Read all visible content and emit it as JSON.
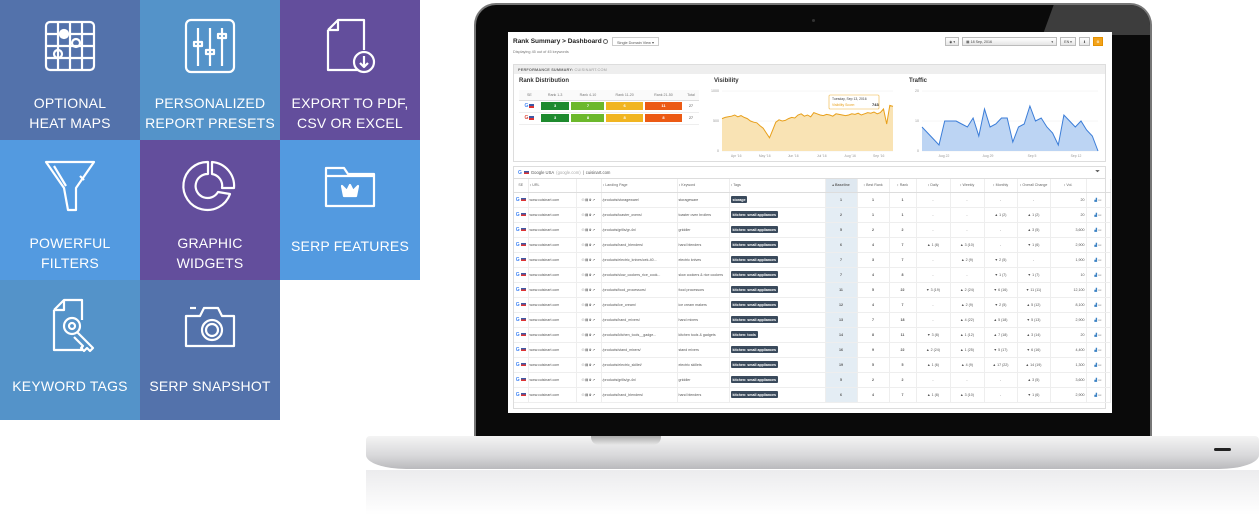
{
  "features": [
    {
      "label": "OPTIONAL\nHEAT MAPS",
      "icon": "heat-map-icon",
      "color": "#5372ab"
    },
    {
      "label": "PERSONALIZED\nREPORT PRESETS",
      "icon": "sliders-icon",
      "color": "#5493c9"
    },
    {
      "label": "EXPORT TO PDF,\nCSV OR EXCEL",
      "icon": "export-file-icon",
      "color": "#634e9c"
    },
    {
      "label": "POWERFUL\nFILTERS",
      "icon": "funnel-icon",
      "color": "#539ae0"
    },
    {
      "label": "GRAPHIC\nWIDGETS",
      "icon": "donut-chart-icon",
      "color": "#634e9c"
    },
    {
      "label": "SERP FEATURES",
      "icon": "folder-crown-icon",
      "color": "#539ae0"
    },
    {
      "label": "KEYWORD TAGS",
      "icon": "document-key-icon",
      "color": "#5493c9"
    },
    {
      "label": "SERP SNAPSHOT",
      "icon": "camera-icon",
      "color": "#5372ab"
    }
  ],
  "app": {
    "title": "Rank Summary > Dashboard",
    "view_select": "Single Domain View",
    "displaying": "Displaying 45 out of 45 keywords",
    "date": "18 Sep, 2016",
    "language": "EN",
    "perf_label": "PERFORMANCE SUMMARY:",
    "perf_domain": "CUISINART.COM"
  },
  "rank_distribution": {
    "title": "Rank Distribution",
    "headers": [
      "SE",
      "Rank 1-3",
      "Rank 4-10",
      "Rank 11-20",
      "Rank 21-50",
      "Total"
    ],
    "rows": [
      {
        "se": "google",
        "values": [
          3,
          7,
          6,
          11
        ],
        "total": 27
      },
      {
        "se": "google-mobile",
        "values": [
          3,
          8,
          8,
          8
        ],
        "total": 27
      }
    ]
  },
  "chart_data": [
    {
      "type": "area",
      "title": "Visibility",
      "ylim": [
        0,
        1000
      ],
      "yticks": [
        "0",
        "500",
        "1000"
      ],
      "xticks": [
        "Apr '16",
        "May '16",
        "Jun '16",
        "Jul '16",
        "Aug '16",
        "Sep '16"
      ],
      "values": [
        540,
        560,
        570,
        580,
        600,
        570,
        590,
        560,
        540,
        500,
        480,
        470,
        420,
        380,
        300,
        220,
        350,
        480,
        520,
        500,
        510,
        540,
        560,
        550,
        600,
        620,
        580,
        600,
        570,
        640,
        620,
        600,
        590,
        610,
        600,
        580,
        620,
        610,
        600,
        590,
        600,
        620,
        610,
        630,
        600,
        620,
        640,
        630,
        650,
        620,
        640,
        700,
        450,
        760,
        743
      ],
      "tooltip": {
        "date": "Tuesday, Sep 13, 2016",
        "label": "Visibility Score:",
        "value": "743"
      }
    },
    {
      "type": "area",
      "title": "Traffic",
      "ylim": [
        0,
        20
      ],
      "yticks": [
        "0",
        "10",
        "20"
      ],
      "xticks": [
        "Aug 22",
        "Aug 29",
        "Sep 5",
        "Sep 12"
      ],
      "values": [
        8,
        6,
        4,
        2,
        10,
        10,
        10,
        9,
        8,
        11,
        5,
        14,
        8,
        9,
        11,
        11,
        3,
        8,
        9,
        15,
        10,
        11,
        8,
        6,
        2,
        12,
        10,
        8,
        10,
        7,
        5,
        0
      ]
    }
  ],
  "keywords": {
    "engine": "Google USA",
    "engine_sub": "(google.com)",
    "domain": "cuisinart.com",
    "headers": [
      "SE",
      "URL",
      "",
      "Landing Page",
      "Keyword",
      "Tags",
      "Baseline",
      "Best Rank",
      "Rank",
      "Daily",
      "Weekly",
      "Monthly",
      "Overall Change",
      "Vol.",
      ""
    ],
    "rows": [
      {
        "url": "www.cuisinart.com",
        "page": "/products/storageware/",
        "kw": "storageware",
        "tag": "storage",
        "base": "1",
        "best": "1",
        "rank": "1",
        "daily": "-",
        "weekly": "-",
        "monthly": "-",
        "overall": "-",
        "vol": "20"
      },
      {
        "url": "www.cuisinart.com",
        "page": "/products/toaster_ovens/",
        "kw": "toaster oven broilers",
        "tag": "kitchen: small appliances",
        "base": "2",
        "best": "1",
        "rank": "1",
        "daily": "-",
        "weekly": "-",
        "monthly": "▲ 1 (2)",
        "overall": "▲ 1 (2)",
        "vol": "20"
      },
      {
        "url": "www.cuisinart.com",
        "page": "/products/grills/gr-4n/",
        "kw": "griddler",
        "tag": "kitchen: small appliances",
        "base": "5",
        "best": "2",
        "rank": "2",
        "daily": "-",
        "weekly": "-",
        "monthly": "-",
        "overall": "▲ 3 (5)",
        "vol": "3,600"
      },
      {
        "url": "www.cuisinart.com",
        "page": "/products/hand_blenders/",
        "kw": "hand blenders",
        "tag": "kitchen: small appliances",
        "base": "6",
        "best": "4",
        "rank": "7",
        "daily": "▲ 1 (8)",
        "weekly": "▲ 3 (10)",
        "monthly": "-",
        "overall": "▼ 1 (6)",
        "vol": "2,900"
      },
      {
        "url": "www.cuisinart.com",
        "page": "/products/electric_knives/cek-40...",
        "kw": "electric knives",
        "tag": "kitchen: small appliances",
        "base": "7",
        "best": "3",
        "rank": "7",
        "daily": "-",
        "weekly": "▲ 2 (9)",
        "monthly": "▼ 2 (5)",
        "overall": "-",
        "vol": "1,900"
      },
      {
        "url": "www.cuisinart.com",
        "page": "/products/slow_cookers_rice_cook...",
        "kw": "slow cookers & rice cookers",
        "tag": "kitchen: small appliances",
        "base": "7",
        "best": "4",
        "rank": "8",
        "daily": "-",
        "weekly": "-",
        "monthly": "▼ 1 (7)",
        "overall": "▼ 1 (7)",
        "vol": "10"
      },
      {
        "url": "www.cuisinart.com",
        "page": "/products/food_processors/",
        "kw": "food processors",
        "tag": "kitchen: small appliances",
        "base": "11",
        "best": "5",
        "rank": "22",
        "daily": "▼ 3 (19)",
        "weekly": "▲ 2 (24)",
        "monthly": "▼ 6 (16)",
        "overall": "▼ 11 (11)",
        "vol": "12,100"
      },
      {
        "url": "www.cuisinart.com",
        "page": "/products/ice_cream/",
        "kw": "ice cream makers",
        "tag": "kitchen: small appliances",
        "base": "12",
        "best": "4",
        "rank": "7",
        "daily": "-",
        "weekly": "▲ 2 (9)",
        "monthly": "▼ 2 (5)",
        "overall": "▲ 5 (12)",
        "vol": "8,100"
      },
      {
        "url": "www.cuisinart.com",
        "page": "/products/hand_mixers/",
        "kw": "hand mixers",
        "tag": "kitchen: small appliances",
        "base": "13",
        "best": "7",
        "rank": "18",
        "daily": "-",
        "weekly": "▲ 4 (22)",
        "monthly": "▲ 5 (18)",
        "overall": "▼ 5 (13)",
        "vol": "2,900"
      },
      {
        "url": "www.cuisinart.com",
        "page": "/products/kitchen_tools__gadge...",
        "kw": "kitchen tools & gadgets",
        "tag": "kitchen: tools",
        "base": "14",
        "best": "8",
        "rank": "11",
        "daily": "▼ 3 (8)",
        "weekly": "▲ 1 (12)",
        "monthly": "▲ 7 (18)",
        "overall": "▲ 3 (14)",
        "vol": "20"
      },
      {
        "url": "www.cuisinart.com",
        "page": "/products/stand_mixers/",
        "kw": "stand mixers",
        "tag": "kitchen: small appliances",
        "base": "16",
        "best": "9",
        "rank": "22",
        "daily": "▲ 2 (24)",
        "weekly": "▲ 1 (25)",
        "monthly": "▼ 5 (17)",
        "overall": "▼ 6 (16)",
        "vol": "4,400"
      },
      {
        "url": "www.cuisinart.com",
        "page": "/products/electric_skillet/",
        "kw": "electric skillets",
        "tag": "kitchen: small appliances",
        "base": "19",
        "best": "5",
        "rank": "5",
        "daily": "▲ 1 (6)",
        "weekly": "▲ 4 (9)",
        "monthly": "▲ 17 (22)",
        "overall": "▲ 14 (19)",
        "vol": "1,300"
      },
      {
        "url": "www.cuisinart.com",
        "page": "/products/grills/gr-4n/",
        "kw": "griddler",
        "tag": "kitchen: small appliances",
        "base": "5",
        "best": "2",
        "rank": "2",
        "daily": "-",
        "weekly": "-",
        "monthly": "-",
        "overall": "▲ 3 (5)",
        "vol": "3,600"
      },
      {
        "url": "www.cuisinart.com",
        "page": "/products/hand_blenders/",
        "kw": "hand blenders",
        "tag": "kitchen: small appliances",
        "base": "6",
        "best": "4",
        "rank": "7",
        "daily": "▲ 1 (8)",
        "weekly": "▲ 3 (10)",
        "monthly": "-",
        "overall": "▼ 1 (6)",
        "vol": "2,900"
      }
    ]
  }
}
